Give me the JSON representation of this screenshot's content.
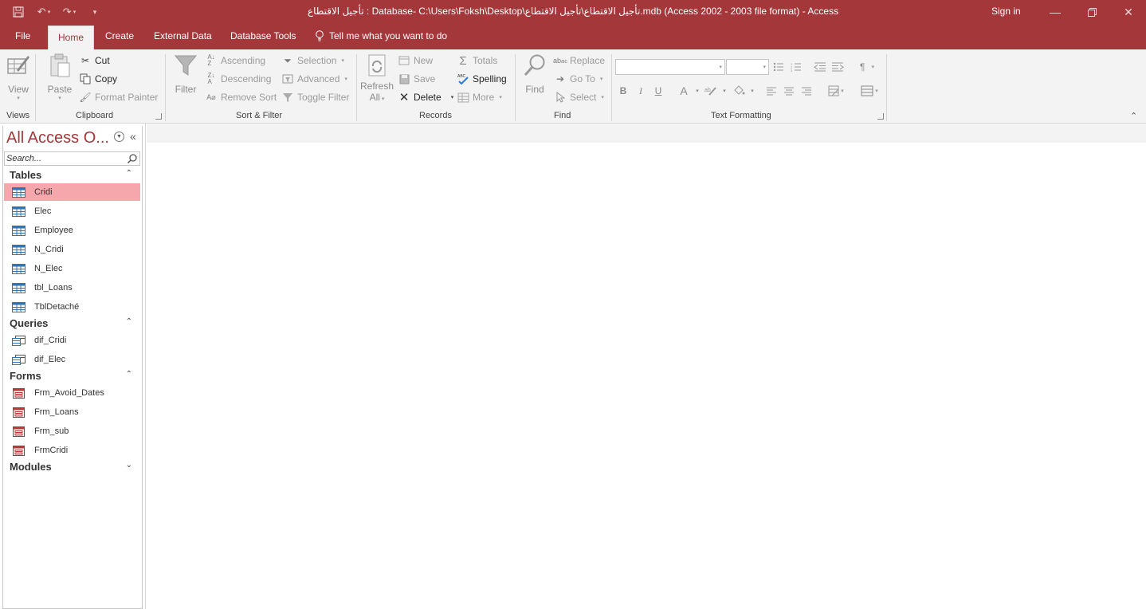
{
  "titlebar": {
    "title": "تأجيل الاقتطاع : Database- C:\\Users\\Foksh\\Desktop\\تأجيل الاقتطاع\\تأجيل الاقتطاع.mdb (Access 2002 - 2003 file format)  -  Access",
    "sign_in": "Sign in"
  },
  "tabs": {
    "file": "File",
    "home": "Home",
    "create": "Create",
    "external_data": "External Data",
    "database_tools": "Database Tools",
    "tell_me": "Tell me what you want to do"
  },
  "ribbon": {
    "views": {
      "view": "View",
      "label": "Views"
    },
    "clipboard": {
      "paste": "Paste",
      "cut": "Cut",
      "copy": "Copy",
      "format_painter": "Format Painter",
      "label": "Clipboard"
    },
    "sort_filter": {
      "filter": "Filter",
      "ascending": "Ascending",
      "descending": "Descending",
      "remove_sort": "Remove Sort",
      "selection": "Selection",
      "advanced": "Advanced",
      "toggle_filter": "Toggle Filter",
      "label": "Sort & Filter"
    },
    "records": {
      "refresh_all_line1": "Refresh",
      "refresh_all_line2": "All",
      "new": "New",
      "save": "Save",
      "delete": "Delete",
      "totals": "Totals",
      "spelling": "Spelling",
      "more": "More",
      "label": "Records"
    },
    "find": {
      "find": "Find",
      "replace": "Replace",
      "go_to": "Go To",
      "select": "Select",
      "label": "Find"
    },
    "text_formatting": {
      "bold": "B",
      "italic": "I",
      "underline": "U",
      "font_color": "A",
      "label": "Text Formatting"
    }
  },
  "nav": {
    "title": "All Access O...",
    "search_placeholder": "Search...",
    "tables": {
      "label": "Tables",
      "items": [
        "Cridi",
        "Elec",
        "Employee",
        "N_Cridi",
        "N_Elec",
        "tbl_Loans",
        "TblDetaché"
      ]
    },
    "queries": {
      "label": "Queries",
      "items": [
        "dif_Cridi",
        "dif_Elec"
      ]
    },
    "forms": {
      "label": "Forms",
      "items": [
        "Frm_Avoid_Dates",
        "Frm_Loans",
        "Frm_sub",
        "FrmCridi"
      ]
    },
    "modules": {
      "label": "Modules"
    }
  },
  "colors": {
    "accent": "#a4373a",
    "selected_item": "#f6a7ab",
    "ribbon_bg": "#f3f3f3"
  }
}
